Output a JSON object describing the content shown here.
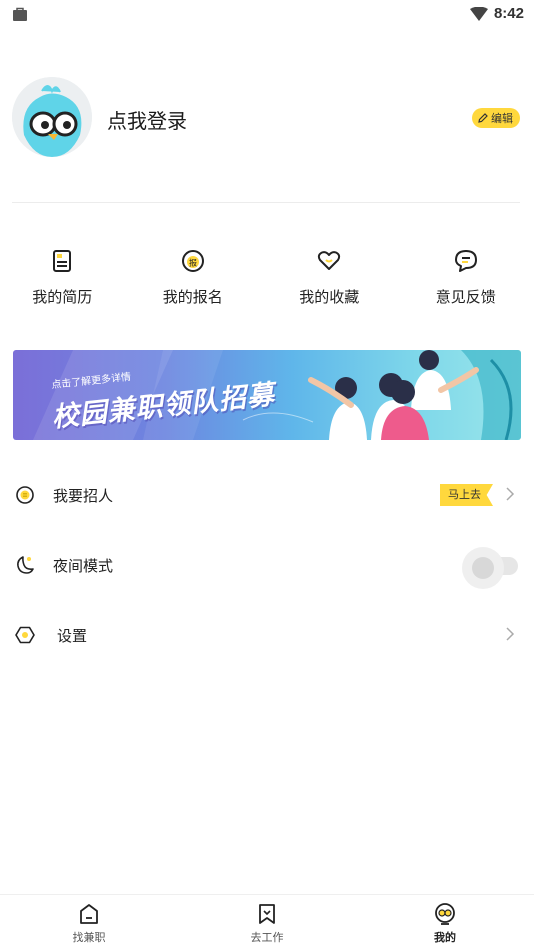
{
  "status_bar": {
    "time": "8:42"
  },
  "profile": {
    "login_text": "点我登录",
    "edit_label": "编辑"
  },
  "quick_actions": [
    {
      "label": "我的简历",
      "icon": "resume-icon"
    },
    {
      "label": "我的报名",
      "icon": "signup-icon",
      "icon_text": "报"
    },
    {
      "label": "我的收藏",
      "icon": "favorite-heart-icon"
    },
    {
      "label": "意见反馈",
      "icon": "feedback-icon"
    }
  ],
  "banner": {
    "subtitle": "点击了解更多详情",
    "title": "校园兼职领队招募"
  },
  "menu": {
    "recruit": {
      "label": "我要招人",
      "badge": "马上去",
      "icon": "recruit-icon"
    },
    "night_mode": {
      "label": "夜间模式",
      "icon": "moon-icon",
      "enabled": false
    },
    "settings": {
      "label": "设置",
      "icon": "settings-icon"
    }
  },
  "tabbar": [
    {
      "label": "找兼职",
      "icon": "home-icon",
      "active": false
    },
    {
      "label": "去工作",
      "icon": "bookmark-icon",
      "active": false
    },
    {
      "label": "我的",
      "icon": "profile-bird-icon",
      "active": true
    }
  ],
  "colors": {
    "accent": "#ffd83d",
    "text": "#222222",
    "divider": "#ececec"
  }
}
